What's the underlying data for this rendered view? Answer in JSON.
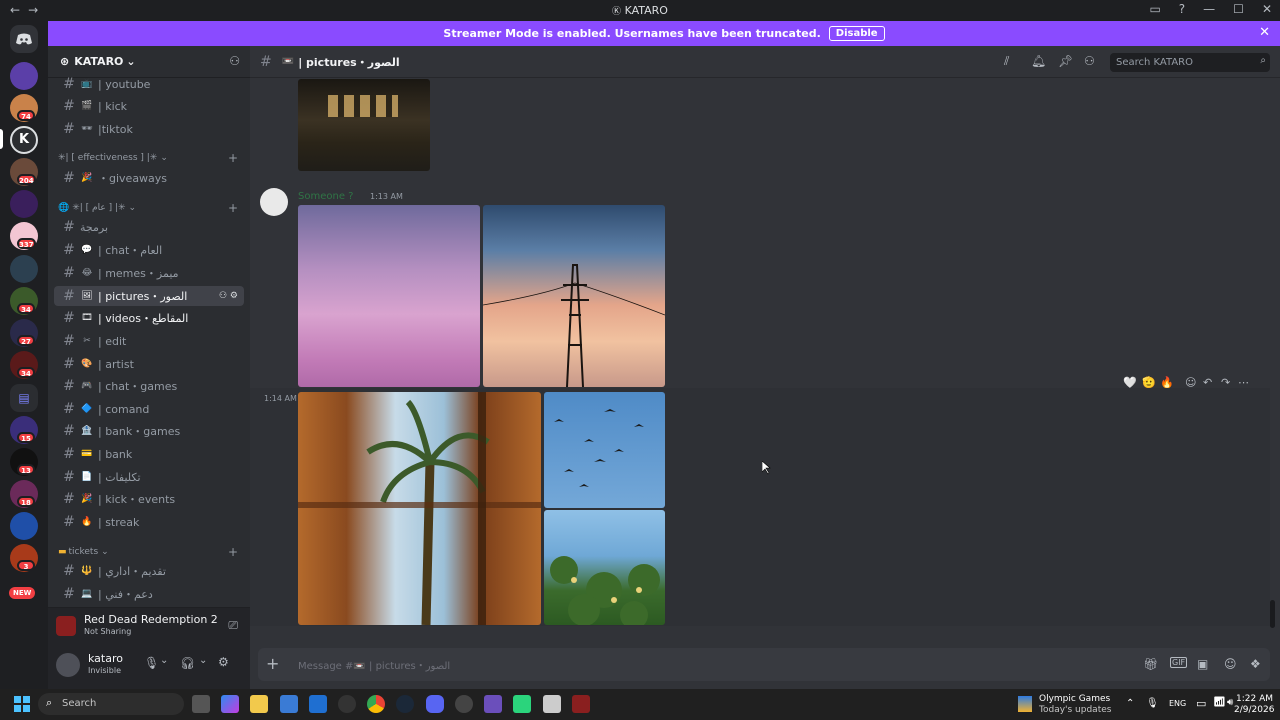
{
  "window": {
    "title": "KATARO",
    "nav_back": "←",
    "nav_forward": "→",
    "controls": [
      "▭",
      "?",
      "—",
      "☐",
      "✕"
    ]
  },
  "banner": {
    "text": "Streamer Mode is enabled. Usernames have been truncated.",
    "disable_label": "Disable",
    "close": "✕"
  },
  "servers": {
    "badges": [
      "74",
      "204",
      "337",
      "34",
      "27",
      "34",
      "15",
      "13",
      "18",
      "3"
    ],
    "new_label": "NEW"
  },
  "guild": {
    "name": "KATARO",
    "chevron": "⌄"
  },
  "channels": {
    "top": [
      {
        "emoji": "📺",
        "label": "| youtube"
      },
      {
        "emoji": "🎬",
        "label": "| kick"
      },
      {
        "emoji": "🕶",
        "label": "|tiktok"
      }
    ],
    "cat_effectiveness": "✳| [ effectiveness ] |✳",
    "effectiveness": [
      {
        "emoji": "🎉",
        "label": "・giveaways"
      }
    ],
    "cat_public": "✳| [ عام ] |✳",
    "public": [
      {
        "emoji": "",
        "label": "برمجة"
      },
      {
        "emoji": "💬",
        "label": "| chat・العام"
      },
      {
        "emoji": "😂",
        "label": "| memes・ميمز"
      },
      {
        "emoji": "🖼",
        "label": "| pictures・الصور"
      },
      {
        "emoji": "🎞",
        "label": "| videos・المقاطع"
      },
      {
        "emoji": "✂",
        "label": "| edit"
      },
      {
        "emoji": "🎨",
        "label": "| artist"
      },
      {
        "emoji": "🎮",
        "label": "| chat・games"
      },
      {
        "emoji": "🔷",
        "label": "| comand"
      },
      {
        "emoji": "🏦",
        "label": "| bank・games"
      },
      {
        "emoji": "💳",
        "label": "| bank"
      },
      {
        "emoji": "📄",
        "label": "| تكليفات"
      },
      {
        "emoji": "🎉",
        "label": "| kick・events"
      },
      {
        "emoji": "🔥",
        "label": "| streak"
      }
    ],
    "cat_tickets": "tickets",
    "tickets": [
      {
        "emoji": "🔱",
        "label": "| تقديم・اداري"
      },
      {
        "emoji": "💻",
        "label": "| دعم・فني"
      }
    ]
  },
  "activity": {
    "game": "Red Dead Redemption 2",
    "status": "Not Sharing"
  },
  "user": {
    "name": "kataro",
    "status": "Invisible"
  },
  "chat": {
    "channel": "| pictures・الصور",
    "search_placeholder": "Search KATARO",
    "messages": [
      {
        "author": "Someone ?",
        "time": "1:13 AM"
      },
      {
        "time": "1:14 AM"
      }
    ],
    "reactions": [
      "🤍",
      "🫡",
      "🔥"
    ],
    "composer_placeholder": "Message #📼 | pictures・الصور"
  },
  "taskbar": {
    "search": "Search",
    "news_title": "Olympic Games",
    "news_sub": "Today's updates",
    "lang": "ENG",
    "time": "1:22 AM",
    "date": "2/9/2026"
  }
}
